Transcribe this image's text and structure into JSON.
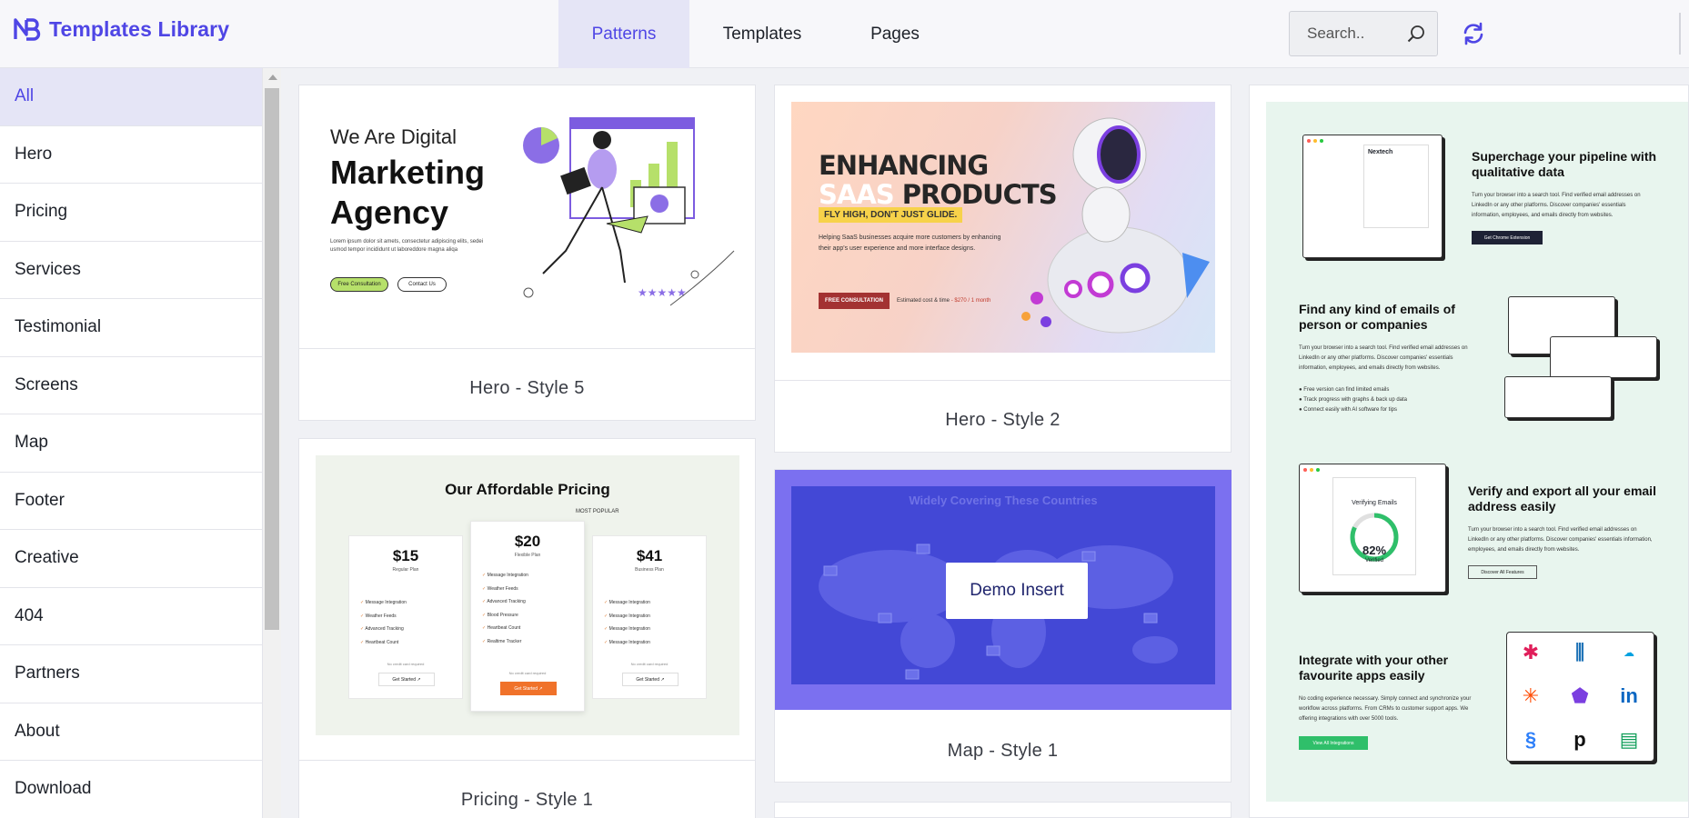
{
  "app": {
    "title": "Templates Library"
  },
  "header": {
    "tabs": [
      {
        "label": "Patterns",
        "active": true
      },
      {
        "label": "Templates",
        "active": false
      },
      {
        "label": "Pages",
        "active": false
      }
    ],
    "search": {
      "placeholder": "Search..",
      "value": ""
    },
    "icons": {
      "search": "search-icon",
      "sync": "sync-icon"
    }
  },
  "sidebar": {
    "items": [
      {
        "label": "All",
        "active": true
      },
      {
        "label": "Hero"
      },
      {
        "label": "Pricing"
      },
      {
        "label": "Services"
      },
      {
        "label": "Testimonial"
      },
      {
        "label": "Screens"
      },
      {
        "label": "Map"
      },
      {
        "label": "Footer"
      },
      {
        "label": "Creative"
      },
      {
        "label": "404"
      },
      {
        "label": "Partners"
      },
      {
        "label": "About"
      },
      {
        "label": "Download"
      }
    ]
  },
  "cards": {
    "hero5": {
      "label": "Hero - Style 5",
      "preview": {
        "line1": "We Are Digital",
        "line2": "Marketing",
        "line3": "Agency",
        "text": "Lorem ipsum dolor sit amets, consectetur adipiscing elits, sedei usmod tempor incididunt ut laboreddore magna aliqa",
        "btn1": "Free Consultation",
        "btn2": "Contact Us"
      }
    },
    "hero2": {
      "label": "Hero - Style 2",
      "preview": {
        "line1": "ENHANCING",
        "saas": "SAAS",
        "products": "PRODUCTS",
        "tag": "FLY HIGH, DON'T JUST GLIDE.",
        "text": "Helping SaaS businesses acquire more customers by enhancing their app's user experience and more interface designs.",
        "cta": "FREE CONSULTATION",
        "est_label": "Estimated cost & time",
        "est_value": "- $270 / 1 month"
      }
    },
    "pricing1": {
      "label": "Pricing - Style 1",
      "preview": {
        "title": "Our Affordable Pricing",
        "most_popular": "MOST POPULAR",
        "plans": [
          {
            "price": "$15",
            "name": "Regular Plan",
            "features": [
              "Message Integration",
              "Weather Feeds",
              "Advanced Tracking",
              "Heartbeat Count"
            ],
            "note": "No credit card required",
            "button": "Get Started ↗"
          },
          {
            "price": "$20",
            "name": "Flexible Plan",
            "features": [
              "Message Integration",
              "Weather Feeds",
              "Advanced Tracking",
              "Blood Pressure",
              "Heartbeat Count",
              "Realtime Tracker"
            ],
            "note": "No credit card required",
            "button": "Get Started ↗"
          },
          {
            "price": "$41",
            "name": "Business Plan",
            "features": [
              "Message Integration",
              "Message Integration",
              "Message Integration",
              "Message Integration"
            ],
            "note": "No credit card required",
            "button": "Get Started ↗"
          }
        ]
      }
    },
    "map1": {
      "label": "Map - Style 1",
      "preview": {
        "title": "Widely Covering These Countries"
      },
      "demo_button": "Demo Insert"
    },
    "services": {
      "sections": [
        {
          "heading": "Superchage your pipeline with qualitative data",
          "text": "Turn your browser into a search tool. Find verified email addresses on LinkedIn or any other platforms. Discover companies' essentials information, employees, and emails directly from websites.",
          "button": "Get Chrome Extension"
        },
        {
          "heading": "Find any kind of emails of person or companies",
          "text": "Turn your browser into a search tool. Find verified email addresses on LinkedIn or any other platforms. Discover companies' essentials information, employees, and emails directly from websites.",
          "bullets": [
            "Free version can find limited emails",
            "Track progress with graphs & back up data",
            "Connect easily with AI software for tips"
          ]
        },
        {
          "heading": "Verify and export all your email address easily",
          "text": "Turn your browser into a search tool. Find verified email addresses on LinkedIn or any other platforms. Discover companies' essentials information, employees, and emails directly from websites.",
          "button": "Discover All Features",
          "verify_label": "Verifying Emails",
          "verify_pct": "82%",
          "verify_sub": "Verified"
        },
        {
          "heading": "Integrate with your other favourite apps easily",
          "text": "No coding experience necessary. Simply connect and synchronize your workflow across platforms. From CRMs to customer support apps. We offering integrations with over 5000 tools.",
          "button": "View All Integrations"
        }
      ],
      "brand": "Nextech"
    }
  },
  "colors": {
    "accent": "#4f46e5",
    "active_bg": "#e5e5f6",
    "map_bg": "#4348d6",
    "services_bg": "#e8f5ee"
  }
}
